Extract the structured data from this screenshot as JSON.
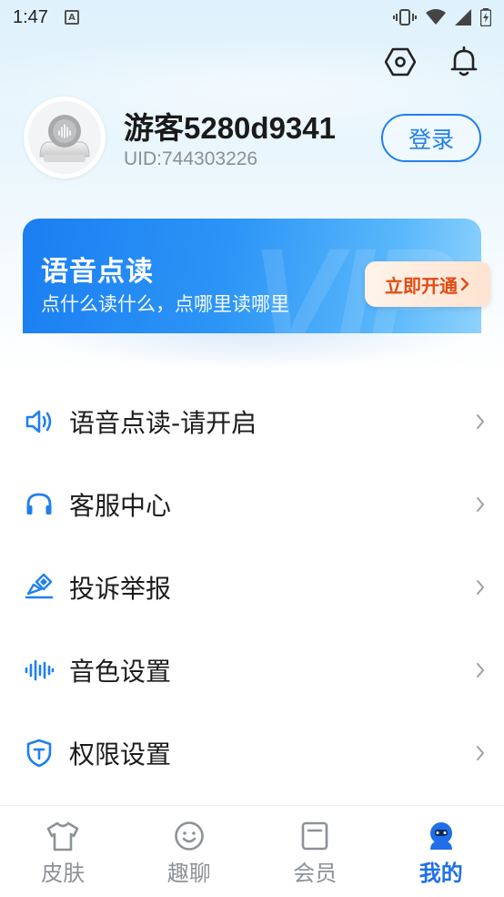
{
  "status_bar": {
    "time": "1:47",
    "notification_icon": "A"
  },
  "header": {
    "settings_icon": "hexagon-settings-icon",
    "bell_icon": "bell-icon"
  },
  "profile": {
    "username": "游客5280d9341",
    "uid": "UID:744303226",
    "login_label": "登录"
  },
  "vip_banner": {
    "title": "语音点读",
    "subtitle": "点什么读什么，点哪里读哪里",
    "button_label": "立即开通",
    "watermark": "VIP"
  },
  "menu": {
    "items": [
      {
        "label": "语音点读-请开启",
        "icon": "speaker-icon"
      },
      {
        "label": "客服中心",
        "icon": "headset-icon"
      },
      {
        "label": "投诉举报",
        "icon": "report-icon"
      },
      {
        "label": "音色设置",
        "icon": "soundwave-icon"
      },
      {
        "label": "权限设置",
        "icon": "shield-icon"
      }
    ]
  },
  "bottom_nav": {
    "items": [
      {
        "label": "皮肤",
        "icon": "shirt-icon",
        "active": false
      },
      {
        "label": "趣聊",
        "icon": "smile-icon",
        "active": false
      },
      {
        "label": "会员",
        "icon": "member-card-icon",
        "active": false
      },
      {
        "label": "我的",
        "icon": "profile-icon",
        "active": true
      }
    ]
  },
  "colors": {
    "accent": "#1f7ff0",
    "vip_button_text": "#e24b12",
    "nav_active": "#1f6fe8",
    "nav_inactive": "#8d9297"
  }
}
